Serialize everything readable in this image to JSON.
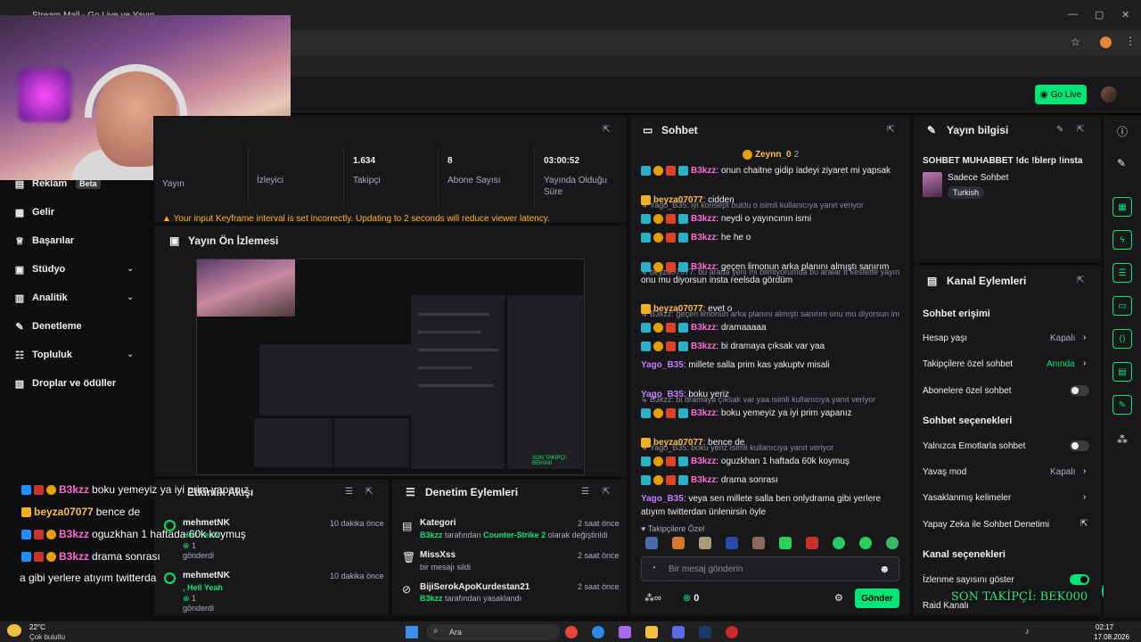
{
  "browser": {
    "tab_title": "Stream Mall - Go Live ve Yayın",
    "window_controls": [
      "—",
      "▢",
      "✕"
    ]
  },
  "header": {
    "go_live_label": "Go Live"
  },
  "sidebar": {
    "items": [
      {
        "label": "Reklam",
        "badge": "Beta",
        "icon": "megaphone-icon"
      },
      {
        "label": "Gelir",
        "icon": "chart-icon"
      },
      {
        "label": "Başarılar",
        "icon": "trophy-icon"
      },
      {
        "label": "Stüdyo",
        "icon": "studio-icon",
        "expandable": true
      },
      {
        "label": "Analitik",
        "icon": "analytics-icon",
        "expandable": true
      },
      {
        "label": "Denetleme",
        "icon": "wrench-icon"
      },
      {
        "label": "Topluluk",
        "icon": "community-icon",
        "expandable": true
      },
      {
        "label": "Droplar ve ödüller",
        "icon": "gift-icon"
      }
    ]
  },
  "overlay_chat": [
    {
      "user": "B3kzz",
      "text": "boku yemeyiz ya iyi prim yapanız"
    },
    {
      "user": "beyza07077",
      "text": "bence de"
    },
    {
      "user": "B3kzz",
      "text": "oguzkhan 1 haftada 60k koymuş"
    },
    {
      "user": "B3kzz",
      "text": "drama sonrası"
    },
    {
      "user": "",
      "text": "a gibi yerlere atıyım twitterda"
    }
  ],
  "stats": {
    "items": [
      {
        "value": "",
        "label": "Yayın"
      },
      {
        "value": "",
        "label": "İzleyici"
      },
      {
        "value": "1.634",
        "label": "Takipçi"
      },
      {
        "value": "8",
        "label": "Abone Sayısı"
      },
      {
        "value": "03:00:52",
        "label": "Yayında Olduğu Süre"
      }
    ],
    "warning": "Your input Keyframe interval is set incorrectly. Updating to 2 seconds will reduce viewer latency."
  },
  "preview": {
    "title": "Yayın Ön İzlemesi",
    "overlay_text": "SON TAKİPÇİ: BEK000"
  },
  "activity": {
    "title": "Etkinlik Akışı",
    "events": [
      {
        "user": "mehmetNK",
        "time": "10 dakika önce",
        "detail": "Hell Yeah",
        "count": "1",
        "action": "gönderdi"
      },
      {
        "user": "mehmetNK",
        "time": "10 dakika önce",
        "detail": ", Hell Yeah",
        "count": "1",
        "action": "gönderdi"
      }
    ]
  },
  "moderation": {
    "title": "Denetim Eylemleri",
    "items": [
      {
        "title": "Kategori",
        "time": "2 saat önce",
        "actor": "B3kzz",
        "mid": "tarafından",
        "target": "Counter-Strike 2",
        "tail": "olarak değiştirildi"
      },
      {
        "title": "MissXss",
        "time": "2 saat önce",
        "sub": "bir mesajı sildi"
      },
      {
        "title": "BijiSerokApoKurdestan21",
        "time": "2 saat önce",
        "actor": "B3kzz",
        "tail": "tarafından yasaklandı"
      }
    ]
  },
  "chat": {
    "title": "Sohbet",
    "pinned_user": "Zeynn_0",
    "pinned_count": "2",
    "messages": [
      {
        "user": "B3kzz",
        "text": ": onun chaitne gidip iadeyi ziyaret mi yapsak",
        "color": "pink"
      },
      {
        "reply": "Yago_B35: iyi konsept buldu o isimli kullanıcıya yanıt veriyor"
      },
      {
        "user": "beyza07077",
        "text": ": cidden",
        "color": "gold"
      },
      {
        "user": "B3kzz",
        "text": ": neydi o yayıncının ismi",
        "color": "pink"
      },
      {
        "user": "B3kzz",
        "text": ": he he o",
        "color": "pink"
      },
      {
        "reply": "beyza07077: bu arada yeni mi bilmiyorumda bu aralar tt kesfette yayın..."
      },
      {
        "user": "B3kzz",
        "text": ": geçen limonun arka planını almıştı sanırım",
        "cont": "onu mu diyorsun insta reelsda gördüm",
        "color": "pink"
      },
      {
        "reply": "B3kzz: geçen limonun arka planını almıştı sanırım onu mu diyorsun ins..."
      },
      {
        "user": "beyza07077",
        "text": ": evet o",
        "color": "gold"
      },
      {
        "user": "B3kzz",
        "text": ": dramaaaaa",
        "color": "pink"
      },
      {
        "user": "B3kzz",
        "text": ": bi dramaya çıksak var yaa",
        "color": "pink"
      },
      {
        "user": "Yago_B35",
        "text": ": millete salla prim kas yakuptv misali",
        "color": "purple"
      },
      {
        "reply": "B3kzz: bi dramaya çıksak var yaa isimli kullanıcıya yanıt veriyor"
      },
      {
        "user": "Yago_B35",
        "text": ": boku yeriz",
        "color": "purple"
      },
      {
        "user": "B3kzz",
        "text": ": boku yemeyiz ya iyi prim yapanız",
        "color": "pink"
      },
      {
        "reply": "Yago_B35: boku yeriz isimli kullanıcıya yanıt veriyor"
      },
      {
        "user": "beyza07077",
        "text": ": bence de",
        "color": "gold"
      },
      {
        "user": "B3kzz",
        "text": ": oguzkhan 1 haftada 60k koymuş",
        "color": "pink"
      },
      {
        "user": "B3kzz",
        "text": ": drama sonrası",
        "color": "pink"
      },
      {
        "user": "Yago_B35",
        "text": ": veya sen millete salla ben onlydrama gibi yerlere",
        "cont": "atıyım twitterdan ünlenirsin öyle",
        "color": "purple"
      }
    ],
    "follower_only": "Takipçilere Özel",
    "input_placeholder": "Bir mesaj gönderin",
    "points": "0",
    "send_label": "Gönder"
  },
  "stream_info": {
    "title": "Yayın bilgisi",
    "stream_title": "SOHBET MUHABBET !dc !blerp !insta",
    "category": "Sadece Sohbet",
    "tag": "Turkish"
  },
  "channel_actions": {
    "title": "Kanal Eylemleri",
    "sections": [
      {
        "heading": "Sohbet erişimi",
        "rows": [
          {
            "label": "Hesap yaşı",
            "value": "Kapalı",
            "kind": "chevron"
          },
          {
            "label": "Takipçilere özel sohbet",
            "value": "Anında",
            "kind": "chevron",
            "accent": true
          },
          {
            "label": "Abonelere özel sohbet",
            "kind": "toggle",
            "on": false
          }
        ]
      },
      {
        "heading": "Sohbet seçenekleri",
        "rows": [
          {
            "label": "Yalnızca Emotlarla sohbet",
            "kind": "toggle",
            "on": false
          },
          {
            "label": "Yavaş mod",
            "value": "Kapalı",
            "kind": "chevron"
          },
          {
            "label": "Yasaklanmış kelimeler",
            "kind": "chevron"
          },
          {
            "label": "Yapay Zeka ile Sohbet Denetimi",
            "kind": "external"
          }
        ]
      },
      {
        "heading": "Kanal seçenekleri",
        "rows": [
          {
            "label": "İzlenme sayısını göster",
            "kind": "toggle",
            "on": true
          },
          {
            "label": "Raid Kanalı",
            "kind": "none"
          }
        ]
      }
    ]
  },
  "overlay_follower": "SON TAKİPÇİ: BEK000",
  "taskbar": {
    "weather_temp": "22°C",
    "weather_text": "Çok bulutlu",
    "search_label": "Ara",
    "time": "02:17",
    "date": "17.08.2026"
  },
  "colors": {
    "accent": "#00e676",
    "bg": "#0e0e10",
    "panel": "#18181b",
    "pink": "#ff6bd6",
    "gold": "#ffc046",
    "purple": "#c47cff"
  }
}
